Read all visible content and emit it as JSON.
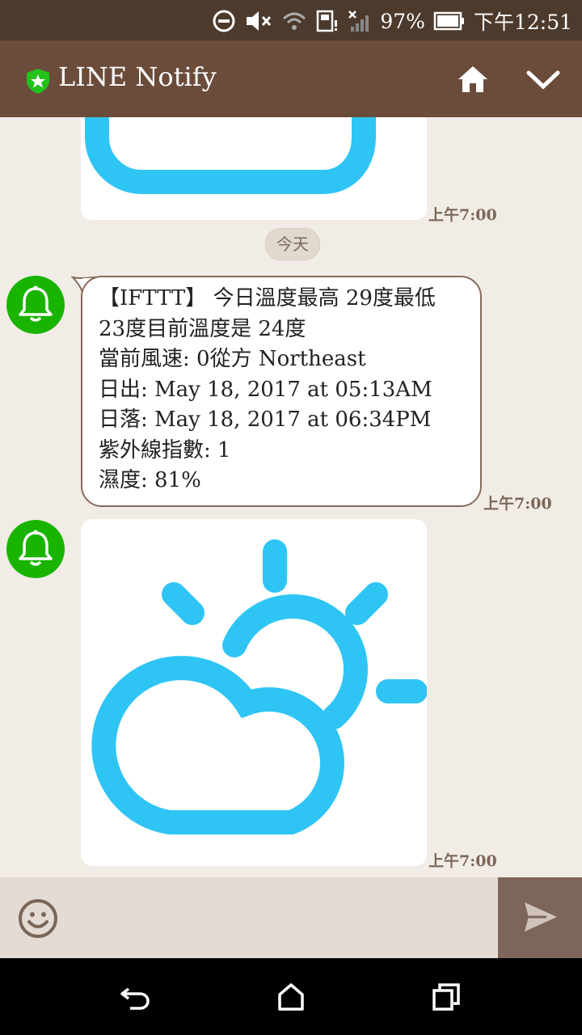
{
  "status_bar": {
    "battery_percent": "97%",
    "time": "下午12:51"
  },
  "app_bar": {
    "title": "LINE Notify",
    "icons": [
      "shield-icon",
      "home-icon",
      "chevron-down-icon"
    ]
  },
  "chat": {
    "date_separator": "今天",
    "messages": [
      {
        "type": "image",
        "icon": "cloud-icon",
        "time": "上午7:00"
      },
      {
        "type": "text",
        "lines": [
          "【IFTTT】 今日溫度最高 29度最低",
          "23度目前溫度是 24度",
          "當前風速: 0從方 Northeast",
          "日出: May 18, 2017 at 05:13AM",
          "日落: May 18, 2017 at 06:34PM",
          "紫外線指數: 1",
          "濕度: 81%"
        ],
        "time": "上午7:00"
      },
      {
        "type": "image",
        "icon": "partly-cloudy-icon",
        "time": "上午7:00"
      }
    ]
  },
  "input": {
    "placeholder": "",
    "icons": [
      "emoji-icon",
      "send-icon"
    ]
  },
  "nav_bar": {
    "icons": [
      "back-icon",
      "home-nav-icon",
      "recents-icon"
    ]
  },
  "colors": {
    "status_bar": "#4c3a2d",
    "app_bar": "#6b4c3b",
    "background": "#f1ece6",
    "weather_blue": "#2ec5f5",
    "bot_green": "#18b400",
    "bubble_border": "#8a6b5b"
  }
}
